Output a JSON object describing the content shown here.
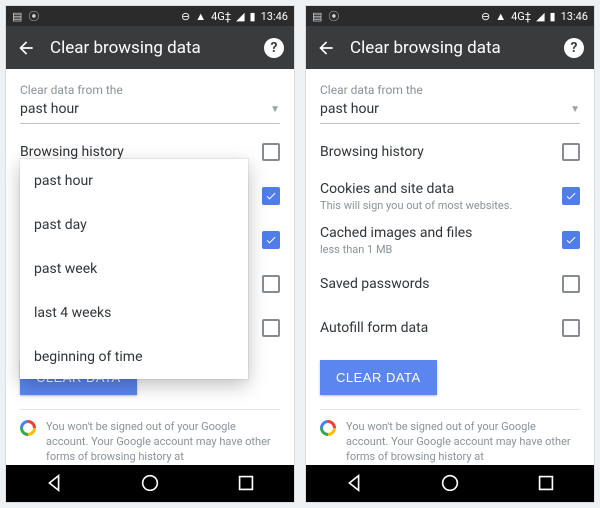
{
  "status": {
    "time": "13:46",
    "net": "4G‡"
  },
  "appbar": {
    "title": "Clear browsing data"
  },
  "hint": "Clear data from the",
  "select": {
    "value": "past hour"
  },
  "options": {
    "o0": "past hour",
    "o1": "past day",
    "o2": "past week",
    "o3": "last 4 weeks",
    "o4": "beginning of time"
  },
  "rows": {
    "browsing": {
      "label": "Browsing history"
    },
    "cookies": {
      "label": "Cookies and site data",
      "sub": "This will sign you out of most websites."
    },
    "cache": {
      "label": "Cached images and files",
      "sub": "less than 1 MB"
    },
    "pwd": {
      "label": "Saved passwords"
    },
    "autofill": {
      "label": "Autofill form data"
    }
  },
  "button": {
    "clear": "CLEAR DATA"
  },
  "footer": "You won't be signed out of your Google account. Your Google account may have other forms of browsing history at"
}
